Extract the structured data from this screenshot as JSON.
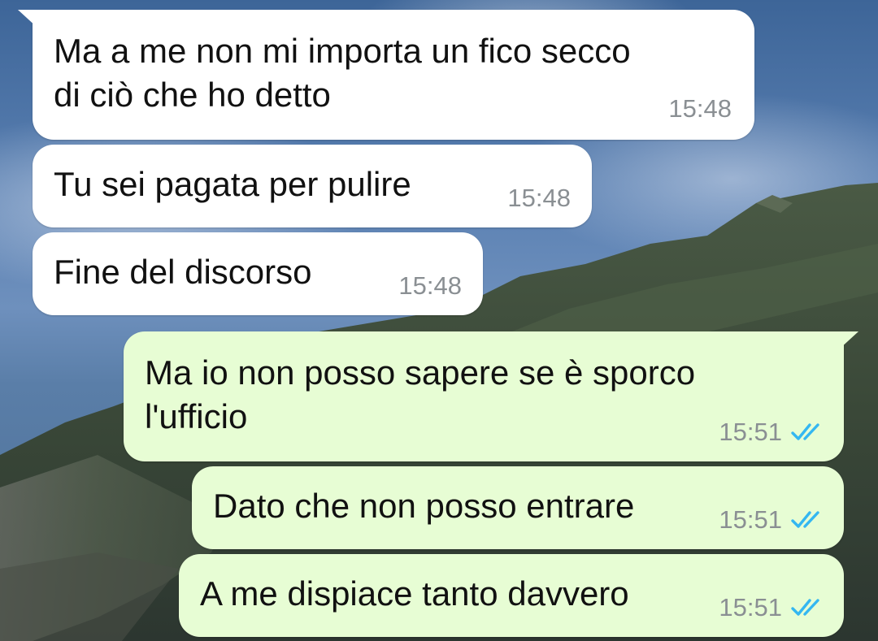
{
  "messages": [
    {
      "direction": "incoming",
      "lines": [
        "Ma a me non mi importa un fico secco",
        "di ciò che ho detto"
      ],
      "time": "15:48"
    },
    {
      "direction": "incoming",
      "lines": [
        "Tu sei pagata per pulire"
      ],
      "time": "15:48"
    },
    {
      "direction": "incoming",
      "lines": [
        "Fine del discorso"
      ],
      "time": "15:48"
    },
    {
      "direction": "outgoing",
      "lines": [
        "Ma io non posso sapere se è sporco",
        "l'ufficio"
      ],
      "time": "15:51",
      "status": "read",
      "status_icon": "double-check-icon"
    },
    {
      "direction": "outgoing",
      "lines": [
        "Dato che non posso entrare"
      ],
      "time": "15:51",
      "status": "read",
      "status_icon": "double-check-icon"
    },
    {
      "direction": "outgoing",
      "lines": [
        "A me dispiace tanto davvero"
      ],
      "time": "15:51",
      "status": "read",
      "status_icon": "double-check-icon"
    }
  ],
  "colors": {
    "incoming_bubble": "#ffffff",
    "outgoing_bubble": "#e7fdd4",
    "timestamp": "#8a8f93",
    "read_ticks": "#34b7f1"
  }
}
